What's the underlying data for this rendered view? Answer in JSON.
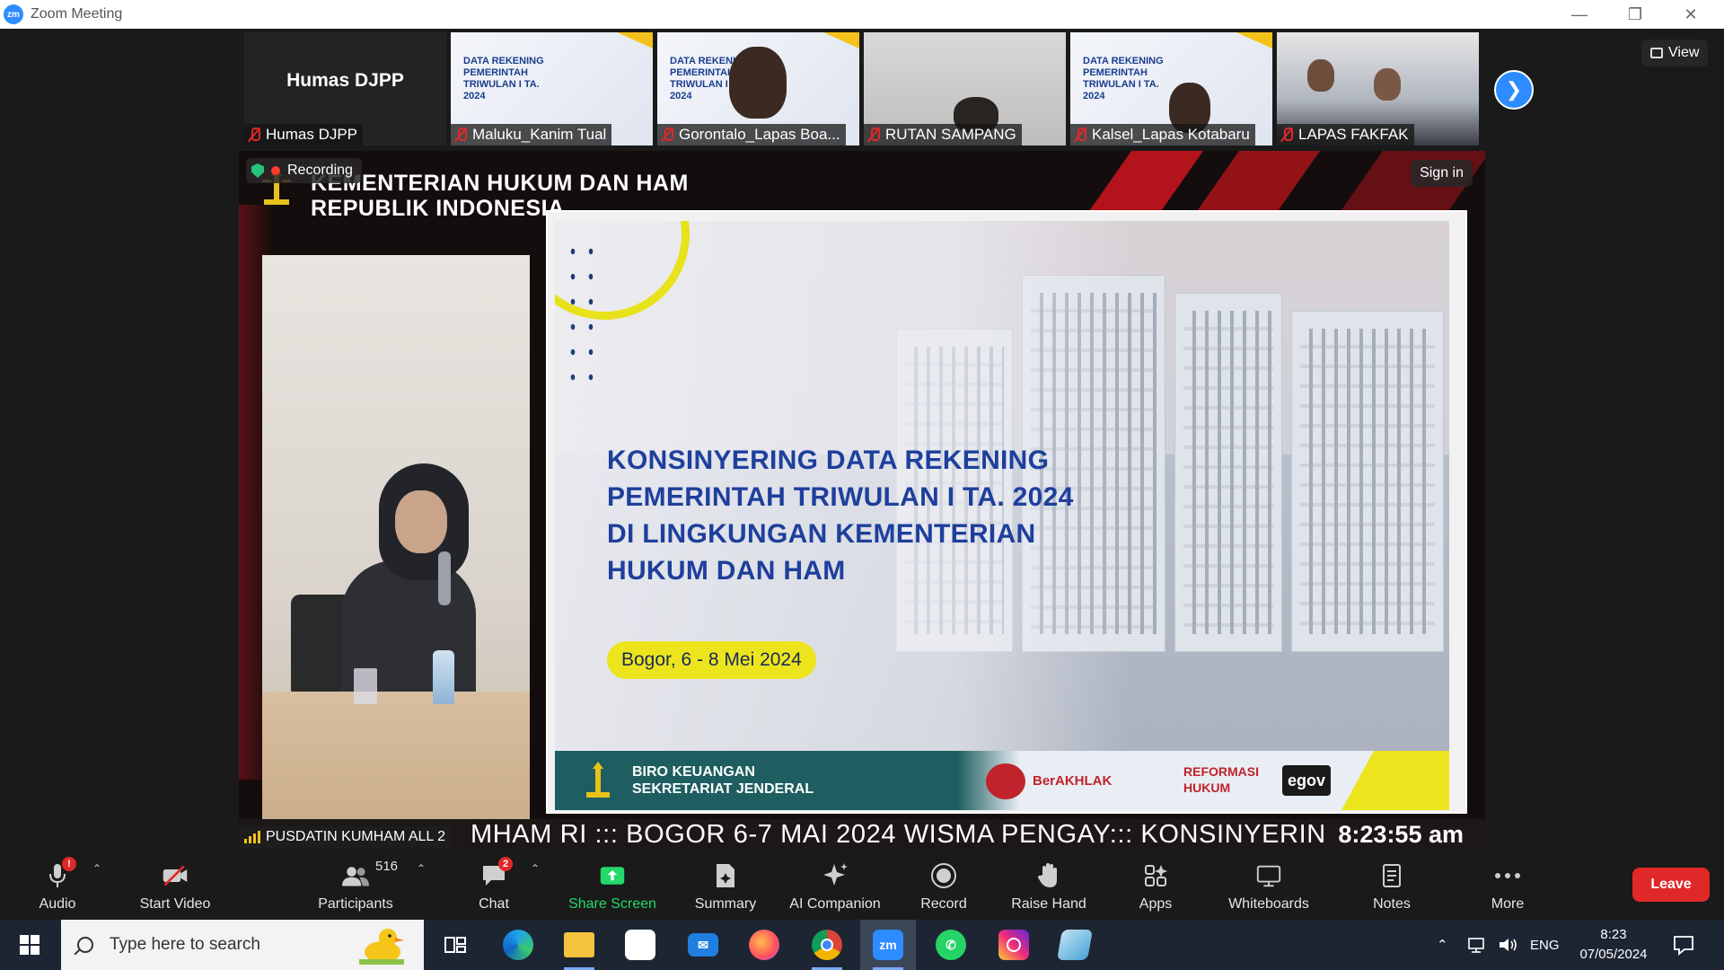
{
  "window": {
    "title": "Zoom Meeting",
    "controls": [
      "minimize",
      "restore",
      "close"
    ]
  },
  "thumbnails": [
    {
      "name": "Humas DJPP",
      "big_name": "Humas DJPP",
      "muted": true
    },
    {
      "name": "Maluku_Kanim Tual",
      "muted": true
    },
    {
      "name": "Gorontalo_Lapas Boa...",
      "muted": true
    },
    {
      "name": "RUTAN SAMPANG",
      "muted": true
    },
    {
      "name": "Kalsel_Lapas Kotabaru",
      "muted": true
    },
    {
      "name": "LAPAS FAKFAK",
      "muted": true
    }
  ],
  "mini_slide_text": "DATA REKENING PEMERINTAH TRIWULAN I TA. 2024",
  "view_button": "View",
  "share": {
    "recording_label": "Recording",
    "sign_in": "Sign in",
    "header_line1": "KEMENTERIAN HUKUM DAN HAM",
    "header_line2": "REPUBLIK INDONESIA",
    "slide_title": "KONSINYERING DATA REKENING PEMERINTAH TRIWULAN I TA. 2024 DI LINGKUNGAN KEMENTERIAN HUKUM DAN HAM",
    "slide_date": "Bogor, 6 - 8 Mei 2024",
    "footer_org_line1": "BIRO KEUANGAN",
    "footer_org_line2": "SEKRETARIAT JENDERAL",
    "footer_logos": [
      "BerAKHLAK",
      "REFORMASI HUKUM",
      "egov"
    ],
    "ticker_text": "MHAM RI ::: BOGOR 6-7 MAI 2024 WISMA PENGAY::: KONSINYERIN",
    "ticker_time": "8:23:55 am",
    "active_speaker": "PUSDATIN KUMHAM ALL 2"
  },
  "toolbar": {
    "audio": {
      "label": "Audio",
      "badge": "!"
    },
    "video": {
      "label": "Start Video"
    },
    "participants": {
      "label": "Participants",
      "count": "516"
    },
    "chat": {
      "label": "Chat",
      "badge": "2"
    },
    "share_screen": {
      "label": "Share Screen"
    },
    "summary": {
      "label": "Summary"
    },
    "ai_companion": {
      "label": "AI Companion"
    },
    "record": {
      "label": "Record"
    },
    "raise_hand": {
      "label": "Raise Hand"
    },
    "apps": {
      "label": "Apps"
    },
    "whiteboards": {
      "label": "Whiteboards"
    },
    "notes": {
      "label": "Notes"
    },
    "more": {
      "label": "More"
    },
    "leave": {
      "label": "Leave"
    }
  },
  "taskbar": {
    "search_placeholder": "Type here to search",
    "zoom_app_label": "zm",
    "language": "ENG",
    "time": "8:23",
    "date": "07/05/2024"
  },
  "colors": {
    "zoom_blue": "#2d8cff",
    "leave_red": "#e02828",
    "share_green": "#23d96a",
    "slide_blue": "#1e3f9c",
    "slide_yellow": "#ece51e"
  }
}
